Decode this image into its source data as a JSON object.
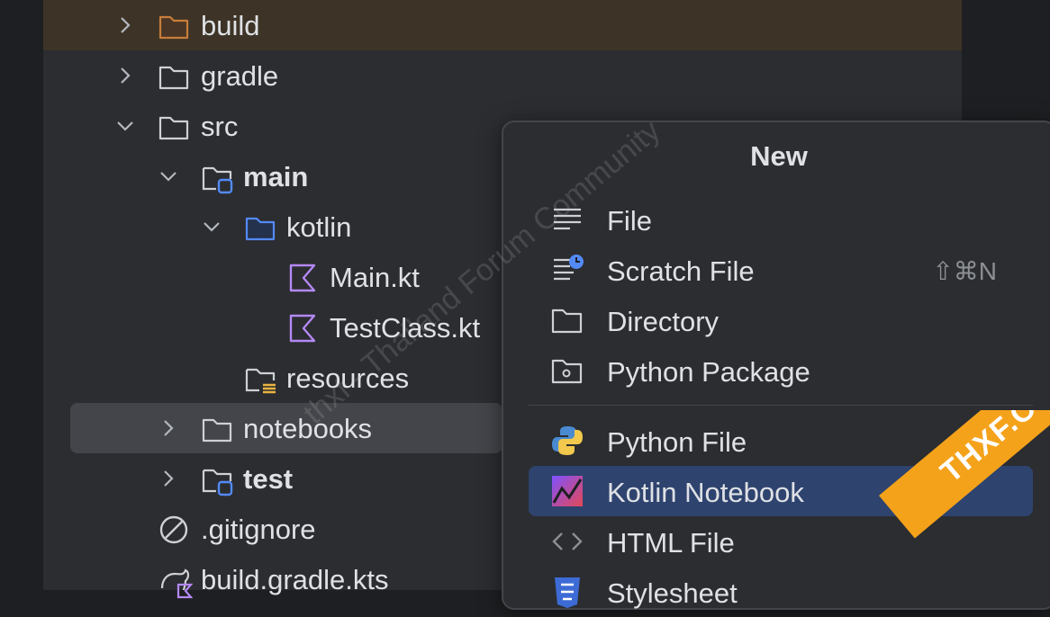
{
  "tree": {
    "items": [
      {
        "label": "build",
        "icon": "folder-excluded-icon"
      },
      {
        "label": "gradle",
        "icon": "folder-icon"
      },
      {
        "label": "src",
        "icon": "folder-icon"
      },
      {
        "label": "main",
        "icon": "source-root-folder-icon"
      },
      {
        "label": "kotlin",
        "icon": "kotlin-source-folder-icon"
      },
      {
        "label": "Main.kt",
        "icon": "kotlin-file-icon"
      },
      {
        "label": "TestClass.kt",
        "icon": "kotlin-file-icon"
      },
      {
        "label": "resources",
        "icon": "resources-folder-icon"
      },
      {
        "label": "notebooks",
        "icon": "folder-icon"
      },
      {
        "label": "test",
        "icon": "test-root-folder-icon"
      },
      {
        "label": ".gitignore",
        "icon": "ignore-file-icon"
      },
      {
        "label": "build.gradle.kts",
        "icon": "gradle-file-icon"
      }
    ]
  },
  "context_menu": {
    "title": "New",
    "items": [
      {
        "label": "File",
        "icon": "file-icon",
        "shortcut": ""
      },
      {
        "label": "Scratch File",
        "icon": "scratch-file-icon",
        "shortcut": "⇧⌘N"
      },
      {
        "label": "Directory",
        "icon": "directory-icon",
        "shortcut": ""
      },
      {
        "label": "Python Package",
        "icon": "python-package-icon",
        "shortcut": ""
      },
      {
        "label": "Python File",
        "icon": "python-file-icon",
        "shortcut": ""
      },
      {
        "label": "Kotlin Notebook",
        "icon": "kotlin-notebook-icon",
        "shortcut": ""
      },
      {
        "label": "HTML File",
        "icon": "html-file-icon",
        "shortcut": ""
      },
      {
        "label": "Stylesheet",
        "icon": "stylesheet-icon",
        "shortcut": ""
      }
    ]
  },
  "watermark": "thxf - Thailand Forum Community",
  "badge": "THXF.ORG",
  "colors": {
    "background": "#1e1f22",
    "panel": "#2b2d30",
    "selection": "#43454a",
    "menu_active": "#2e436e",
    "excluded_folder": "#c77d3b",
    "source_folder": "#548af7",
    "kotlin": "#b488f5",
    "badge": "#f5a21b"
  }
}
